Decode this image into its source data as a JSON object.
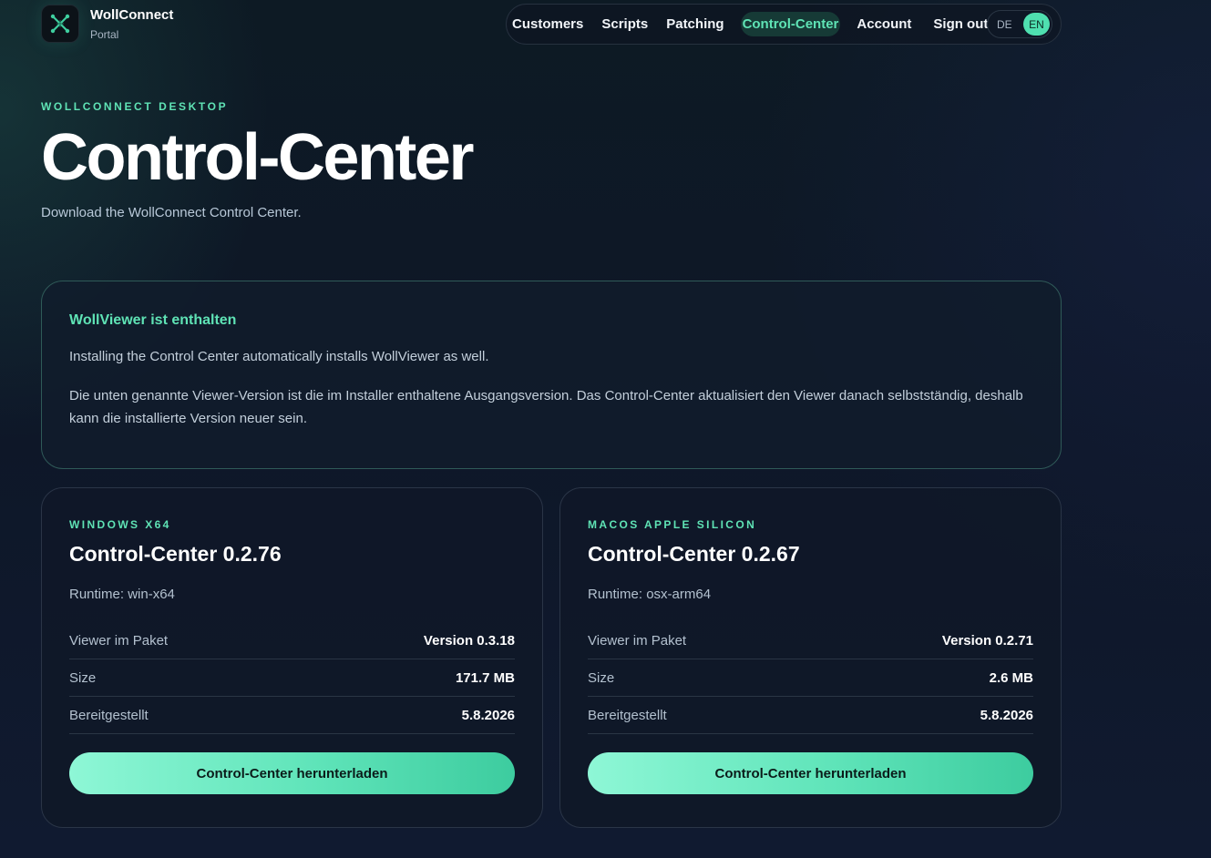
{
  "brand": {
    "name": "WollConnect",
    "sub": "Portal",
    "logo_icon": "crossed-arrows-logo-icon"
  },
  "nav": {
    "items": [
      {
        "label": "Customers",
        "active": false
      },
      {
        "label": "Scripts",
        "active": false
      },
      {
        "label": "Patching",
        "active": false
      },
      {
        "label": "Control-Center",
        "active": true
      },
      {
        "label": "Account",
        "active": false
      },
      {
        "label": "Sign out",
        "active": false
      }
    ],
    "lang": {
      "de": "DE",
      "en": "EN",
      "selected": "EN"
    }
  },
  "hero": {
    "eyebrow": "WOLLCONNECT DESKTOP",
    "title": "Control-Center",
    "subtitle": "Download the WollConnect Control Center."
  },
  "info": {
    "title": "WollViewer ist enthalten",
    "p1": "Installing the Control Center automatically installs WollViewer as well.",
    "p2": "Die unten genannte Viewer-Version ist die im Installer enthaltene Ausgangsversion. Das Control-Center aktualisiert den Viewer danach selbstständig, deshalb kann die installierte Version neuer sein."
  },
  "cards": [
    {
      "platform": "WINDOWS X64",
      "title": "Control-Center 0.2.76",
      "runtime": "Runtime: win-x64",
      "rows": [
        {
          "label": "Viewer im Paket",
          "value": "Version 0.3.18"
        },
        {
          "label": "Size",
          "value": "171.7 MB"
        },
        {
          "label": "Bereitgestellt",
          "value": "5.8.2026"
        }
      ],
      "button": "Control-Center herunterladen"
    },
    {
      "platform": "MACOS APPLE SILICON",
      "title": "Control-Center 0.2.67",
      "runtime": "Runtime: osx-arm64",
      "rows": [
        {
          "label": "Viewer im Paket",
          "value": "Version 0.2.71"
        },
        {
          "label": "Size",
          "value": "2.6 MB"
        },
        {
          "label": "Bereitgestellt",
          "value": "5.8.2026"
        }
      ],
      "button": "Control-Center herunterladen"
    }
  ],
  "colors": {
    "accent": "#5fe3b5",
    "background": "#0e1728",
    "card": "#0f1828"
  }
}
